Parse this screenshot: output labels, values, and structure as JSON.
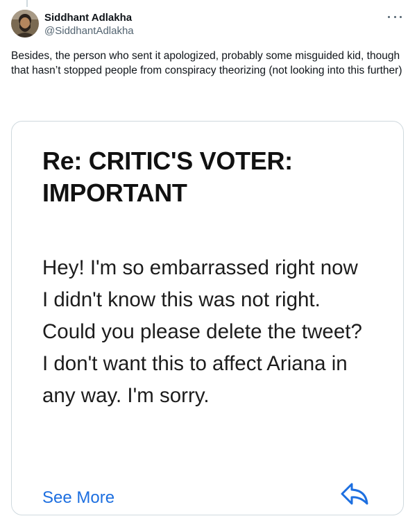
{
  "author": {
    "display_name": "Siddhant Adlakha",
    "handle": "@SiddhantAdlakha",
    "avatar_icon": "user-avatar"
  },
  "tweet": {
    "text": "Besides, the person who sent it apologized, probably some misguided kid, though that hasn’t stopped people from conspiracy theorizing (not looking into this further)"
  },
  "media": {
    "subject": "Re: CRITIC'S VOTER: IMPORTANT",
    "message": "Hey! I'm so embarrassed right now I didn't know this was not right. Could you please delete the tweet? I don't want this to affect Ariana in any way. I'm sorry.",
    "see_more": "See More",
    "reply_icon": "reply-icon"
  },
  "colors": {
    "link": "#1d6fe0",
    "secondary_text": "#536471",
    "border": "#cfd9de"
  }
}
